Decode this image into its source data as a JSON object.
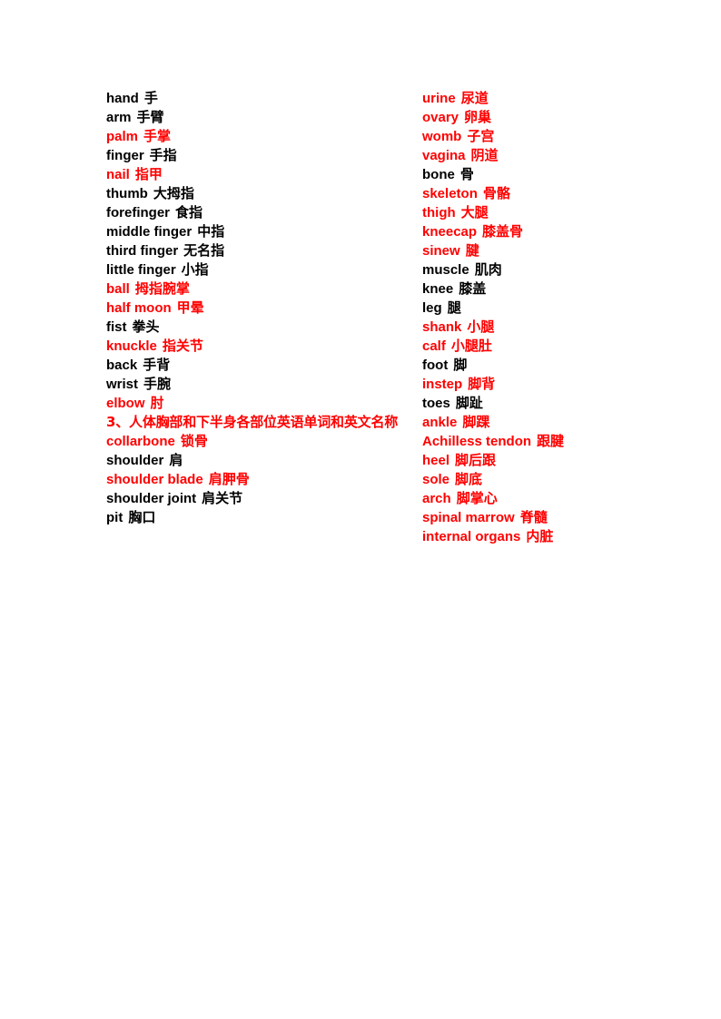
{
  "document": {
    "page_background": "#ffffff",
    "text_colors": {
      "red": "#FF0000",
      "black": "#000000"
    }
  },
  "left_column": [
    {
      "en": "hand",
      "cn": "手",
      "color": "black"
    },
    {
      "en": "arm",
      "cn": "手臂",
      "color": "black"
    },
    {
      "en": "palm",
      "cn": "手掌",
      "color": "red"
    },
    {
      "en": "finger",
      "cn": "手指",
      "color": "black"
    },
    {
      "en": "nail",
      "cn": "指甲",
      "color": "red"
    },
    {
      "en": "thumb",
      "cn": "大拇指",
      "color": "black"
    },
    {
      "en": "forefinger",
      "cn": "食指",
      "color": "black"
    },
    {
      "en": "middle finger",
      "cn": "中指",
      "color": "black"
    },
    {
      "en": "third finger",
      "cn": "无名指",
      "color": "black"
    },
    {
      "en": "little finger",
      "cn": "小指",
      "color": "black"
    },
    {
      "en": "ball",
      "cn": "拇指腕掌",
      "color": "red"
    },
    {
      "en": "half moon",
      "cn": "甲晕",
      "color": "red"
    },
    {
      "en": "fist",
      "cn": "拳头",
      "color": "black"
    },
    {
      "en": "knuckle",
      "cn": "指关节",
      "color": "red"
    },
    {
      "en": "back",
      "cn": "手背",
      "color": "black"
    },
    {
      "en": "wrist",
      "cn": "手腕",
      "color": "black"
    },
    {
      "en": "elbow",
      "cn": "肘",
      "color": "red"
    }
  ],
  "section_heading": {
    "text": "3、人体胸部和下半身各部位英语单词和英文名称",
    "color": "red"
  },
  "left_column_after_heading": [
    {
      "en": "collarbone",
      "cn": "锁骨",
      "color": "red"
    },
    {
      "en": "shoulder",
      "cn": "肩",
      "color": "black"
    },
    {
      "en": "shoulder blade",
      "cn": "肩胛骨",
      "color": "red"
    },
    {
      "en": "shoulder joint",
      "cn": "肩关节",
      "color": "black"
    },
    {
      "en": "pit",
      "cn": "胸口",
      "color": "black"
    }
  ],
  "right_column": [
    {
      "en": "urine",
      "cn": "尿道",
      "color": "red"
    },
    {
      "en": "ovary",
      "cn": "卵巢",
      "color": "red"
    },
    {
      "en": "womb",
      "cn": "子宫",
      "color": "red"
    },
    {
      "en": "vagina",
      "cn": "阴道",
      "color": "red"
    },
    {
      "en": "bone",
      "cn": "骨",
      "color": "black"
    },
    {
      "en": "skeleton",
      "cn": "骨骼",
      "color": "red"
    },
    {
      "en": "thigh",
      "cn": "大腿",
      "color": "red"
    },
    {
      "en": "kneecap",
      "cn": "膝盖骨",
      "color": "red"
    },
    {
      "en": "sinew",
      "cn": "腱",
      "color": "red"
    },
    {
      "en": "muscle",
      "cn": "肌肉",
      "color": "black"
    },
    {
      "en": "knee",
      "cn": "膝盖",
      "color": "black"
    },
    {
      "en": "leg",
      "cn": "腿",
      "color": "black"
    },
    {
      "en": "shank",
      "cn": "小腿",
      "color": "red"
    },
    {
      "en": "calf",
      "cn": "小腿肚",
      "color": "red"
    },
    {
      "en": "foot",
      "cn": "脚",
      "color": "black"
    },
    {
      "en": "instep",
      "cn": "脚背",
      "color": "red"
    },
    {
      "en": "toes",
      "cn": "脚趾",
      "color": "black"
    },
    {
      "en": "ankle",
      "cn": "脚踝",
      "color": "red"
    },
    {
      "en": "Achilless tendon",
      "cn": "跟腱",
      "color": "red"
    },
    {
      "en": "heel",
      "cn": "脚后跟",
      "color": "red"
    },
    {
      "en": "sole",
      "cn": "脚底",
      "color": "red"
    },
    {
      "en": "arch",
      "cn": "脚掌心",
      "color": "red"
    },
    {
      "en": "spinal marrow",
      "cn": "脊髓",
      "color": "red"
    },
    {
      "en": "internal organs",
      "cn": "内脏",
      "color": "red"
    }
  ]
}
